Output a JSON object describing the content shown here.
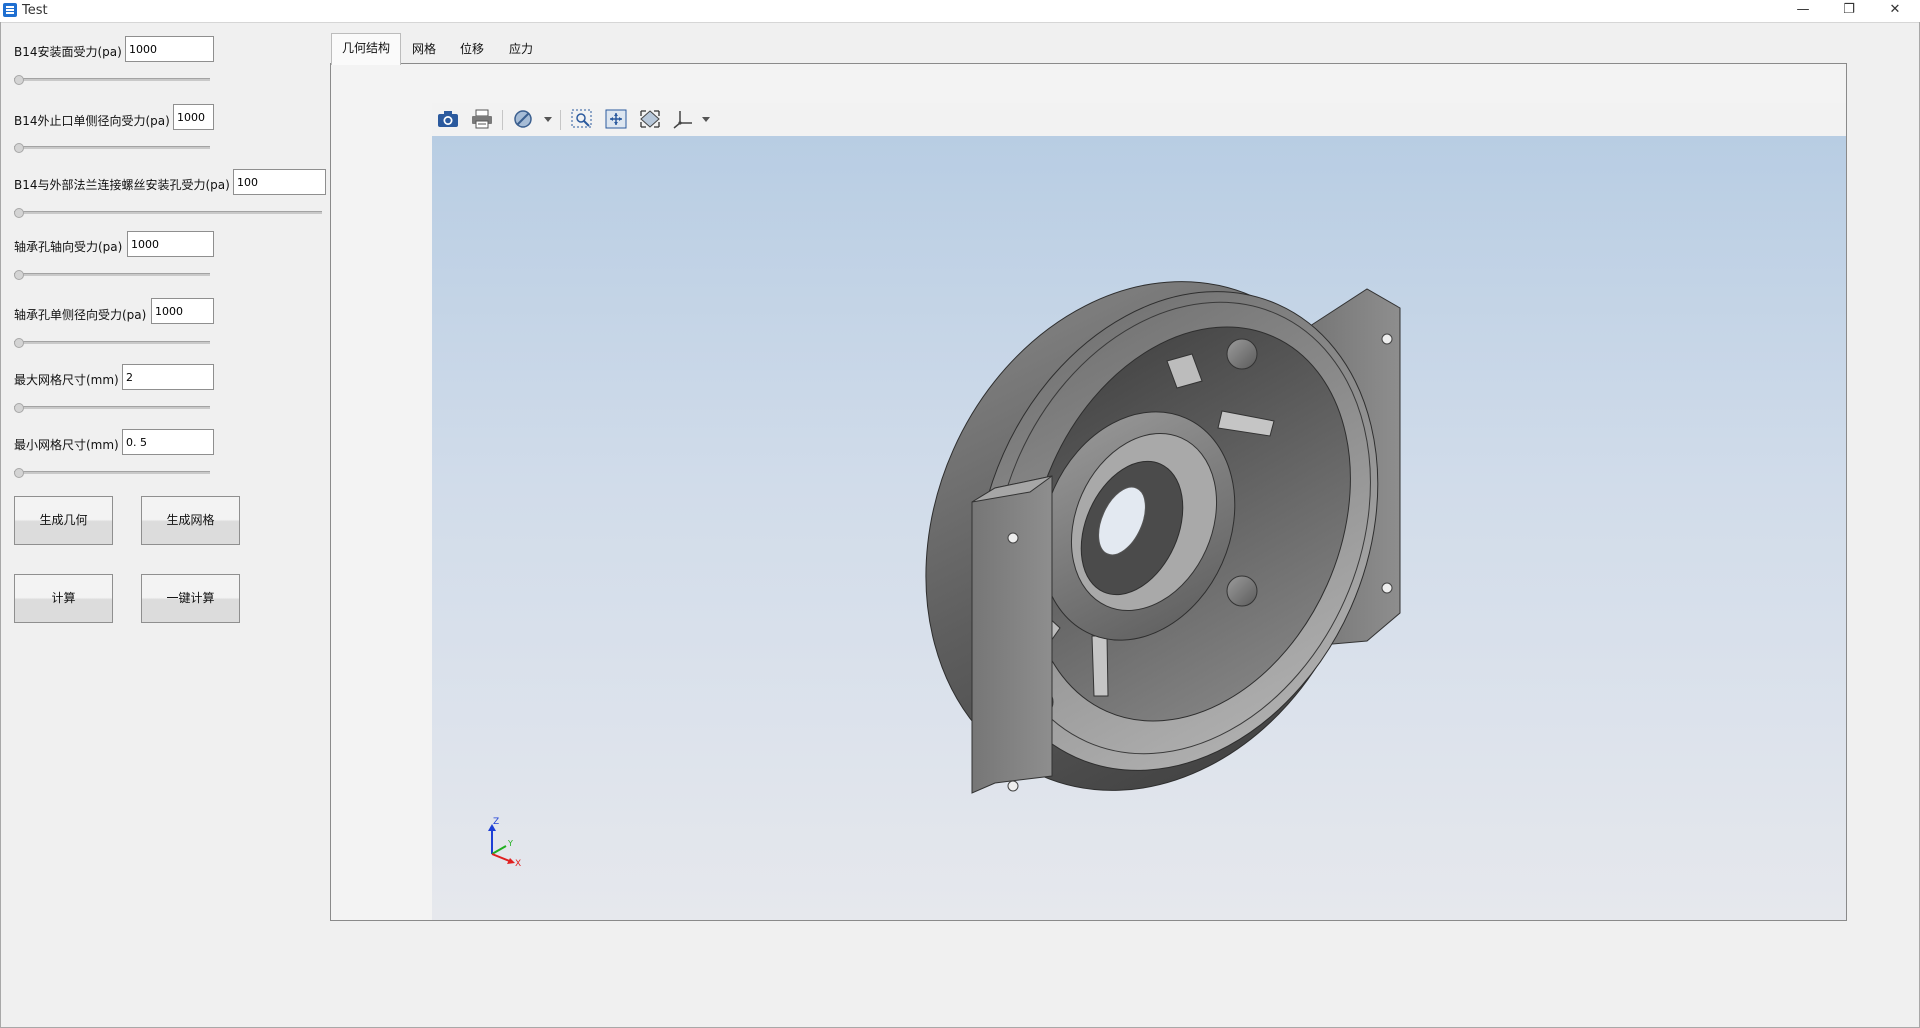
{
  "window": {
    "title": "Test",
    "minimize_glyph": "—",
    "restore_glyph": "❐",
    "close_glyph": "✕"
  },
  "params": [
    {
      "label": "B14安装面受力(pa)",
      "value": "1000",
      "slider_value": 0
    },
    {
      "label": "B14外止口单侧径向受力(pa)",
      "value": "1000",
      "slider_value": 0
    },
    {
      "label": "B14与外部法兰连接螺丝安装孔受力(pa)",
      "value": "100",
      "slider_value": 0
    },
    {
      "label": "轴承孔轴向受力(pa)",
      "value": "1000",
      "slider_value": 0
    },
    {
      "label": "轴承孔单侧径向受力(pa)",
      "value": "1000",
      "slider_value": 0
    },
    {
      "label": "最大网格尺寸(mm)",
      "value": "2",
      "slider_value": 0
    },
    {
      "label": "最小网格尺寸(mm)",
      "value": "0. 5",
      "slider_value": 0
    }
  ],
  "buttons": {
    "gen_geometry": "生成几何",
    "gen_mesh": "生成网格",
    "compute": "计算",
    "one_click": "一键计算"
  },
  "tabs": [
    {
      "label": "几何结构",
      "active": true
    },
    {
      "label": "网格",
      "active": false
    },
    {
      "label": "位移",
      "active": false
    },
    {
      "label": "应力",
      "active": false
    }
  ],
  "toolbar_icons": [
    "camera-icon",
    "print-icon",
    "display-mode-icon",
    "zoom-box-icon",
    "fit-all-icon",
    "rotate-view-icon",
    "axes-view-icon"
  ],
  "axes": {
    "z": "Z",
    "y": "Y",
    "x": "X"
  },
  "colors": {
    "viewport_top": "#b8cde3",
    "viewport_bottom": "#e6e8ed",
    "axis_x": "#e02020",
    "axis_y": "#20b020",
    "axis_z": "#1d3fd6"
  }
}
